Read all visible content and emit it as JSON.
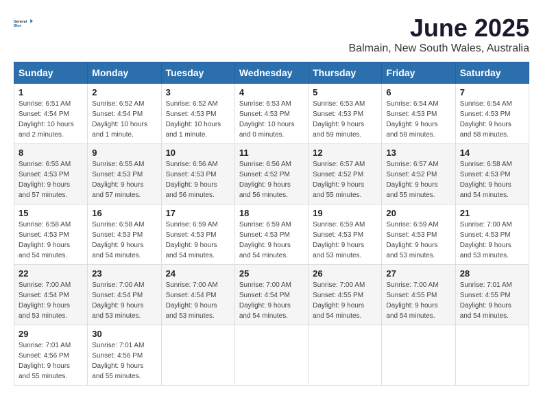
{
  "logo": {
    "general": "General",
    "blue": "Blue"
  },
  "title": "June 2025",
  "subtitle": "Balmain, New South Wales, Australia",
  "headers": [
    "Sunday",
    "Monday",
    "Tuesday",
    "Wednesday",
    "Thursday",
    "Friday",
    "Saturday"
  ],
  "weeks": [
    [
      {
        "day": "1",
        "sunrise": "6:51 AM",
        "sunset": "4:54 PM",
        "daylight": "10 hours and 2 minutes."
      },
      {
        "day": "2",
        "sunrise": "6:52 AM",
        "sunset": "4:54 PM",
        "daylight": "10 hours and 1 minute."
      },
      {
        "day": "3",
        "sunrise": "6:52 AM",
        "sunset": "4:53 PM",
        "daylight": "10 hours and 1 minute."
      },
      {
        "day": "4",
        "sunrise": "6:53 AM",
        "sunset": "4:53 PM",
        "daylight": "10 hours and 0 minutes."
      },
      {
        "day": "5",
        "sunrise": "6:53 AM",
        "sunset": "4:53 PM",
        "daylight": "9 hours and 59 minutes."
      },
      {
        "day": "6",
        "sunrise": "6:54 AM",
        "sunset": "4:53 PM",
        "daylight": "9 hours and 58 minutes."
      },
      {
        "day": "7",
        "sunrise": "6:54 AM",
        "sunset": "4:53 PM",
        "daylight": "9 hours and 58 minutes."
      }
    ],
    [
      {
        "day": "8",
        "sunrise": "6:55 AM",
        "sunset": "4:53 PM",
        "daylight": "9 hours and 57 minutes."
      },
      {
        "day": "9",
        "sunrise": "6:55 AM",
        "sunset": "4:53 PM",
        "daylight": "9 hours and 57 minutes."
      },
      {
        "day": "10",
        "sunrise": "6:56 AM",
        "sunset": "4:53 PM",
        "daylight": "9 hours and 56 minutes."
      },
      {
        "day": "11",
        "sunrise": "6:56 AM",
        "sunset": "4:52 PM",
        "daylight": "9 hours and 56 minutes."
      },
      {
        "day": "12",
        "sunrise": "6:57 AM",
        "sunset": "4:52 PM",
        "daylight": "9 hours and 55 minutes."
      },
      {
        "day": "13",
        "sunrise": "6:57 AM",
        "sunset": "4:52 PM",
        "daylight": "9 hours and 55 minutes."
      },
      {
        "day": "14",
        "sunrise": "6:58 AM",
        "sunset": "4:53 PM",
        "daylight": "9 hours and 54 minutes."
      }
    ],
    [
      {
        "day": "15",
        "sunrise": "6:58 AM",
        "sunset": "4:53 PM",
        "daylight": "9 hours and 54 minutes."
      },
      {
        "day": "16",
        "sunrise": "6:58 AM",
        "sunset": "4:53 PM",
        "daylight": "9 hours and 54 minutes."
      },
      {
        "day": "17",
        "sunrise": "6:59 AM",
        "sunset": "4:53 PM",
        "daylight": "9 hours and 54 minutes."
      },
      {
        "day": "18",
        "sunrise": "6:59 AM",
        "sunset": "4:53 PM",
        "daylight": "9 hours and 54 minutes."
      },
      {
        "day": "19",
        "sunrise": "6:59 AM",
        "sunset": "4:53 PM",
        "daylight": "9 hours and 53 minutes."
      },
      {
        "day": "20",
        "sunrise": "6:59 AM",
        "sunset": "4:53 PM",
        "daylight": "9 hours and 53 minutes."
      },
      {
        "day": "21",
        "sunrise": "7:00 AM",
        "sunset": "4:53 PM",
        "daylight": "9 hours and 53 minutes."
      }
    ],
    [
      {
        "day": "22",
        "sunrise": "7:00 AM",
        "sunset": "4:54 PM",
        "daylight": "9 hours and 53 minutes."
      },
      {
        "day": "23",
        "sunrise": "7:00 AM",
        "sunset": "4:54 PM",
        "daylight": "9 hours and 53 minutes."
      },
      {
        "day": "24",
        "sunrise": "7:00 AM",
        "sunset": "4:54 PM",
        "daylight": "9 hours and 53 minutes."
      },
      {
        "day": "25",
        "sunrise": "7:00 AM",
        "sunset": "4:54 PM",
        "daylight": "9 hours and 54 minutes."
      },
      {
        "day": "26",
        "sunrise": "7:00 AM",
        "sunset": "4:55 PM",
        "daylight": "9 hours and 54 minutes."
      },
      {
        "day": "27",
        "sunrise": "7:00 AM",
        "sunset": "4:55 PM",
        "daylight": "9 hours and 54 minutes."
      },
      {
        "day": "28",
        "sunrise": "7:01 AM",
        "sunset": "4:55 PM",
        "daylight": "9 hours and 54 minutes."
      }
    ],
    [
      {
        "day": "29",
        "sunrise": "7:01 AM",
        "sunset": "4:56 PM",
        "daylight": "9 hours and 55 minutes."
      },
      {
        "day": "30",
        "sunrise": "7:01 AM",
        "sunset": "4:56 PM",
        "daylight": "9 hours and 55 minutes."
      },
      null,
      null,
      null,
      null,
      null
    ]
  ],
  "labels": {
    "sunrise": "Sunrise:",
    "sunset": "Sunset:",
    "daylight": "Daylight:"
  }
}
